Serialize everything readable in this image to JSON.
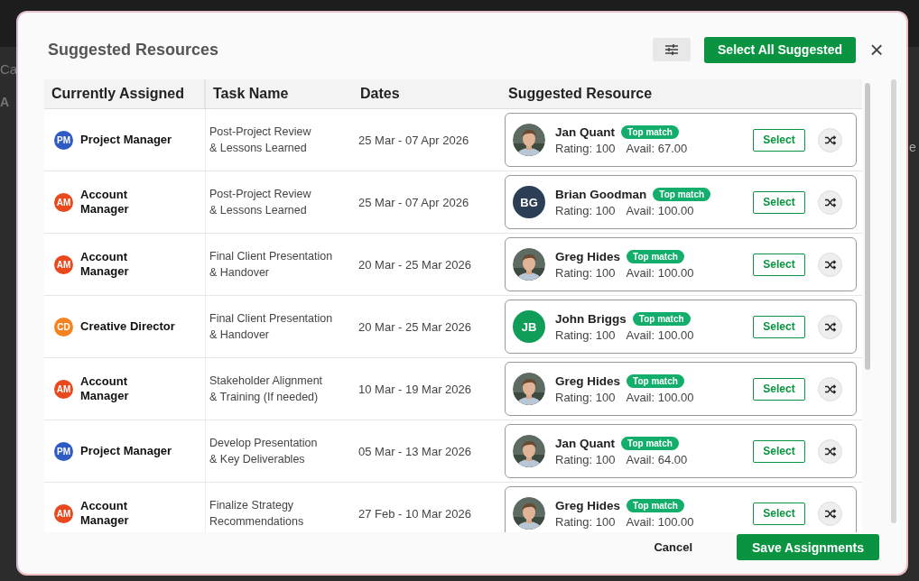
{
  "background": {
    "texts": [
      "Ca",
      "A",
      "e"
    ]
  },
  "dialog": {
    "title": "Suggested Resources",
    "select_all_button": "Select All Suggested",
    "close": "×",
    "table": {
      "columns": [
        "Currently Assigned",
        "Task Name",
        "Dates",
        "Suggested Resource"
      ],
      "rows": [
        {
          "role": {
            "initials": "PM",
            "name": [
              "Project Manager"
            ],
            "color": "#2f5bc4"
          },
          "task": [
            "Post-Project Review",
            "& Lessons Learned"
          ],
          "dates": "25 Mar - 07 Apr 2026",
          "resource": {
            "name": "Jan Quant",
            "badge": "Top match",
            "rating": "Rating: 100",
            "avail": "Avail: 67.00",
            "select": "Select"
          }
        },
        {
          "role": {
            "initials": "AM",
            "name": [
              "Account",
              "Manager"
            ],
            "color": "#e9491d"
          },
          "task": [
            "Post-Project Review",
            "& Lessons Learned"
          ],
          "dates": "25 Mar - 07 Apr 2026",
          "resource": {
            "avatar": {
              "kind": "initials",
              "initials": "BG",
              "color": "#2b3e55"
            },
            "name": "Brian Goodman",
            "badge": "Top match",
            "rating": "Rating: 100",
            "avail": "Avail: 100.00",
            "select": "Select"
          }
        },
        {
          "role": {
            "initials": "AM",
            "name": [
              "Account",
              "Manager"
            ],
            "color": "#e9491d"
          },
          "task": [
            "Final Client Presentation",
            "& Handover"
          ],
          "dates": "20 Mar - 25 Mar 2026",
          "resource": {
            "name": "Greg Hides",
            "badge": "Top match",
            "rating": "Rating: 100",
            "avail": "Avail: 100.00",
            "select": "Select"
          }
        },
        {
          "role": {
            "initials": "CD",
            "name": [
              "Creative Director"
            ],
            "color": "#f5821f"
          },
          "task": [
            "Final Client Presentation",
            "& Handover"
          ],
          "dates": "20 Mar - 25 Mar 2026",
          "resource": {
            "avatar": {
              "kind": "initials",
              "initials": "JB",
              "color": "#0f9d58"
            },
            "name": "John Briggs",
            "badge": "Top match",
            "rating": "Rating: 100",
            "avail": "Avail: 100.00",
            "select": "Select"
          }
        },
        {
          "role": {
            "initials": "AM",
            "name": [
              "Account",
              "Manager"
            ],
            "color": "#e9491d"
          },
          "task": [
            "Stakeholder Alignment",
            "& Training (If needed)"
          ],
          "dates": "10 Mar - 19 Mar 2026",
          "resource": {
            "name": "Greg Hides",
            "badge": "Top match",
            "rating": "Rating: 100",
            "avail": "Avail: 100.00",
            "select": "Select"
          }
        },
        {
          "role": {
            "initials": "PM",
            "name": [
              "Project Manager"
            ],
            "color": "#2f5bc4"
          },
          "task": [
            "Develop Presentation",
            "& Key Deliverables"
          ],
          "dates": "05 Mar - 13 Mar 2026",
          "resource": {
            "name": "Jan Quant",
            "badge": "Top match",
            "rating": "Rating: 100",
            "avail": "Avail: 64.00",
            "select": "Select"
          }
        },
        {
          "role": {
            "initials": "AM",
            "name": [
              "Account",
              "Manager"
            ],
            "color": "#e9491d"
          },
          "task": [
            "Finalize Strategy",
            "Recommendations"
          ],
          "dates": "27 Feb - 10 Mar 2026",
          "resource": {
            "name": "Greg Hides",
            "badge": "Top match",
            "rating": "Rating: 100",
            "avail": "Avail: 100.00",
            "select": "Select"
          }
        }
      ]
    },
    "footer": {
      "cancel": "Cancel",
      "save": "Save Assignments"
    }
  }
}
